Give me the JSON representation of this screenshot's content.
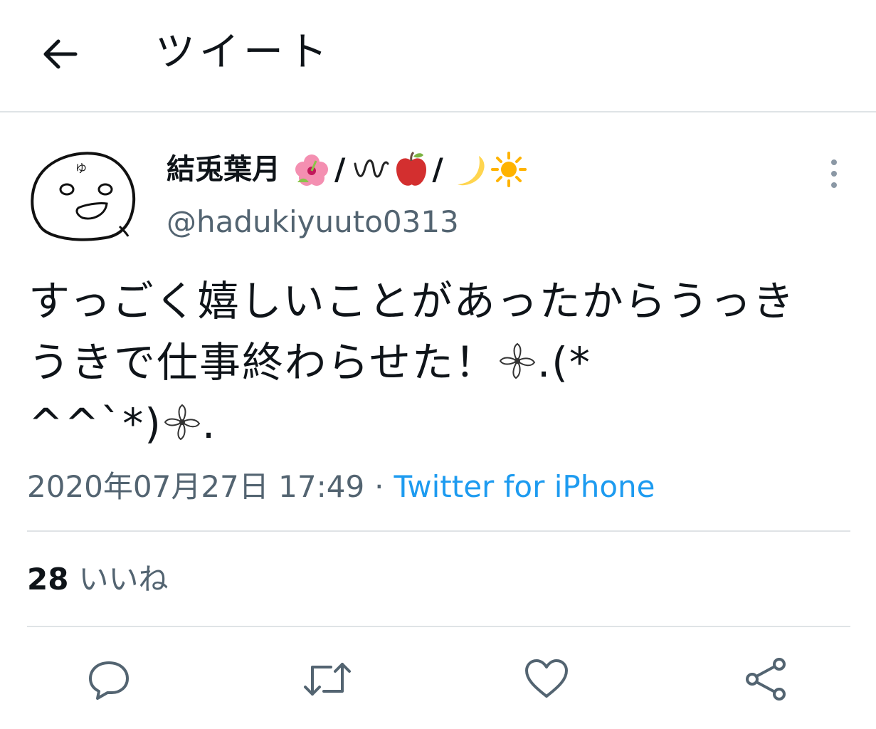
{
  "header": {
    "back_icon": "arrow-left-icon",
    "title": "ツイート"
  },
  "tweet": {
    "author": {
      "display_name": "結兎葉月",
      "name_emojis": [
        "hibiscus-icon",
        "slash",
        "wavy-line-icon",
        "apple-icon",
        "slash",
        "crescent-moon-icon",
        "sun-icon"
      ],
      "slash": "/",
      "handle": "@hadukiyuuto0313",
      "avatar": "smiley-doodle-avatar"
    },
    "text_line1": "すっごく嬉しいことがあったからうっきうきで仕事終わらせた！",
    "text_flower_suffix": ".(*",
    "text_line3_start": "^^`*)",
    "text_line3_end": ".",
    "timestamp": "2020年07月27日 17:49",
    "separator": "·",
    "source": "Twitter for iPhone",
    "likes_count": "28",
    "likes_label": "いいね"
  },
  "actions": [
    "reply-icon",
    "retweet-icon",
    "like-icon",
    "share-icon"
  ],
  "colors": {
    "text": "#0f1419",
    "secondary": "#536471",
    "link": "#1d9bf0",
    "divider": "#dfe3e6",
    "icon": "#536471"
  }
}
